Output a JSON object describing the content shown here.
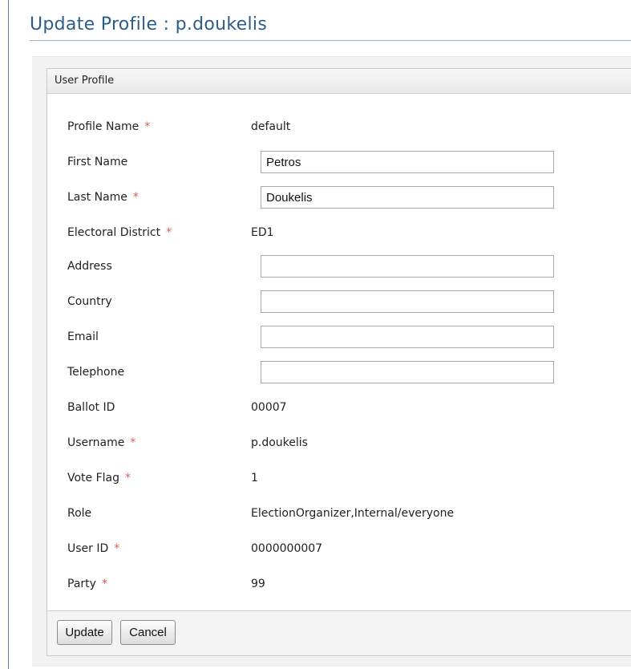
{
  "page": {
    "title": "Update Profile : p.doukelis"
  },
  "panel": {
    "header": "User Profile"
  },
  "fields": [
    {
      "label": "Profile Name",
      "required": true,
      "type": "text",
      "value": "default"
    },
    {
      "label": "First Name",
      "required": false,
      "type": "input",
      "value": "Petros"
    },
    {
      "label": "Last Name",
      "required": true,
      "type": "input",
      "value": "Doukelis"
    },
    {
      "label": "Electoral District",
      "required": true,
      "type": "text",
      "value": "ED1"
    },
    {
      "label": "Address",
      "required": false,
      "type": "input",
      "value": ""
    },
    {
      "label": "Country",
      "required": false,
      "type": "input",
      "value": ""
    },
    {
      "label": "Email",
      "required": false,
      "type": "input",
      "value": ""
    },
    {
      "label": "Telephone",
      "required": false,
      "type": "input",
      "value": ""
    },
    {
      "label": "Ballot ID",
      "required": false,
      "type": "text",
      "value": "00007"
    },
    {
      "label": "Username",
      "required": true,
      "type": "text",
      "value": "p.doukelis"
    },
    {
      "label": "Vote Flag",
      "required": true,
      "type": "text",
      "value": "1"
    },
    {
      "label": "Role",
      "required": false,
      "type": "text",
      "value": "ElectionOrganizer,Internal/everyone"
    },
    {
      "label": "User ID",
      "required": true,
      "type": "text",
      "value": "0000000007"
    },
    {
      "label": "Party",
      "required": true,
      "type": "text",
      "value": "99"
    }
  ],
  "required_marker": "*",
  "buttons": {
    "update": "Update",
    "cancel": "Cancel"
  }
}
